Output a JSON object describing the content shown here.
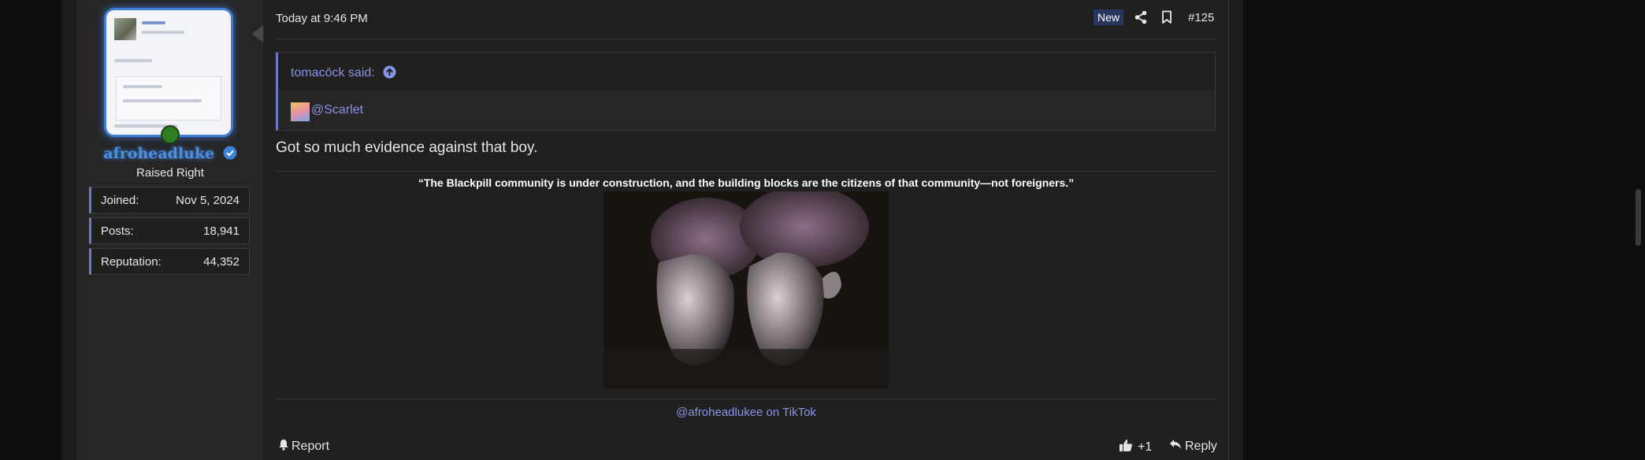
{
  "user": {
    "username": "afroheadluke",
    "title": "Raised Right",
    "online": true,
    "stats": [
      {
        "label": "Joined:",
        "value": "Nov 5, 2024"
      },
      {
        "label": "Posts:",
        "value": "18,941"
      },
      {
        "label": "Reputation:",
        "value": "44,352"
      }
    ]
  },
  "post": {
    "time": "Today at 9:46 PM",
    "badge": "New",
    "number": "#125",
    "quote": {
      "author_label": "tomacōck said:",
      "mention": "@Scarlet"
    },
    "text": "Got so much evidence against that boy."
  },
  "signature": {
    "quote": "“The Blackpill community is under construction, and the building blocks are the citizens of that community—not foreigners.”",
    "link": "@afroheadlukee on TikTok"
  },
  "actions": {
    "report": "Report",
    "like": "+1",
    "reply": "Reply"
  },
  "colors": {
    "accent": "#6e78c9",
    "link": "#8b93e6",
    "username": "#4a8fe0",
    "new_badge": "#27355f"
  }
}
